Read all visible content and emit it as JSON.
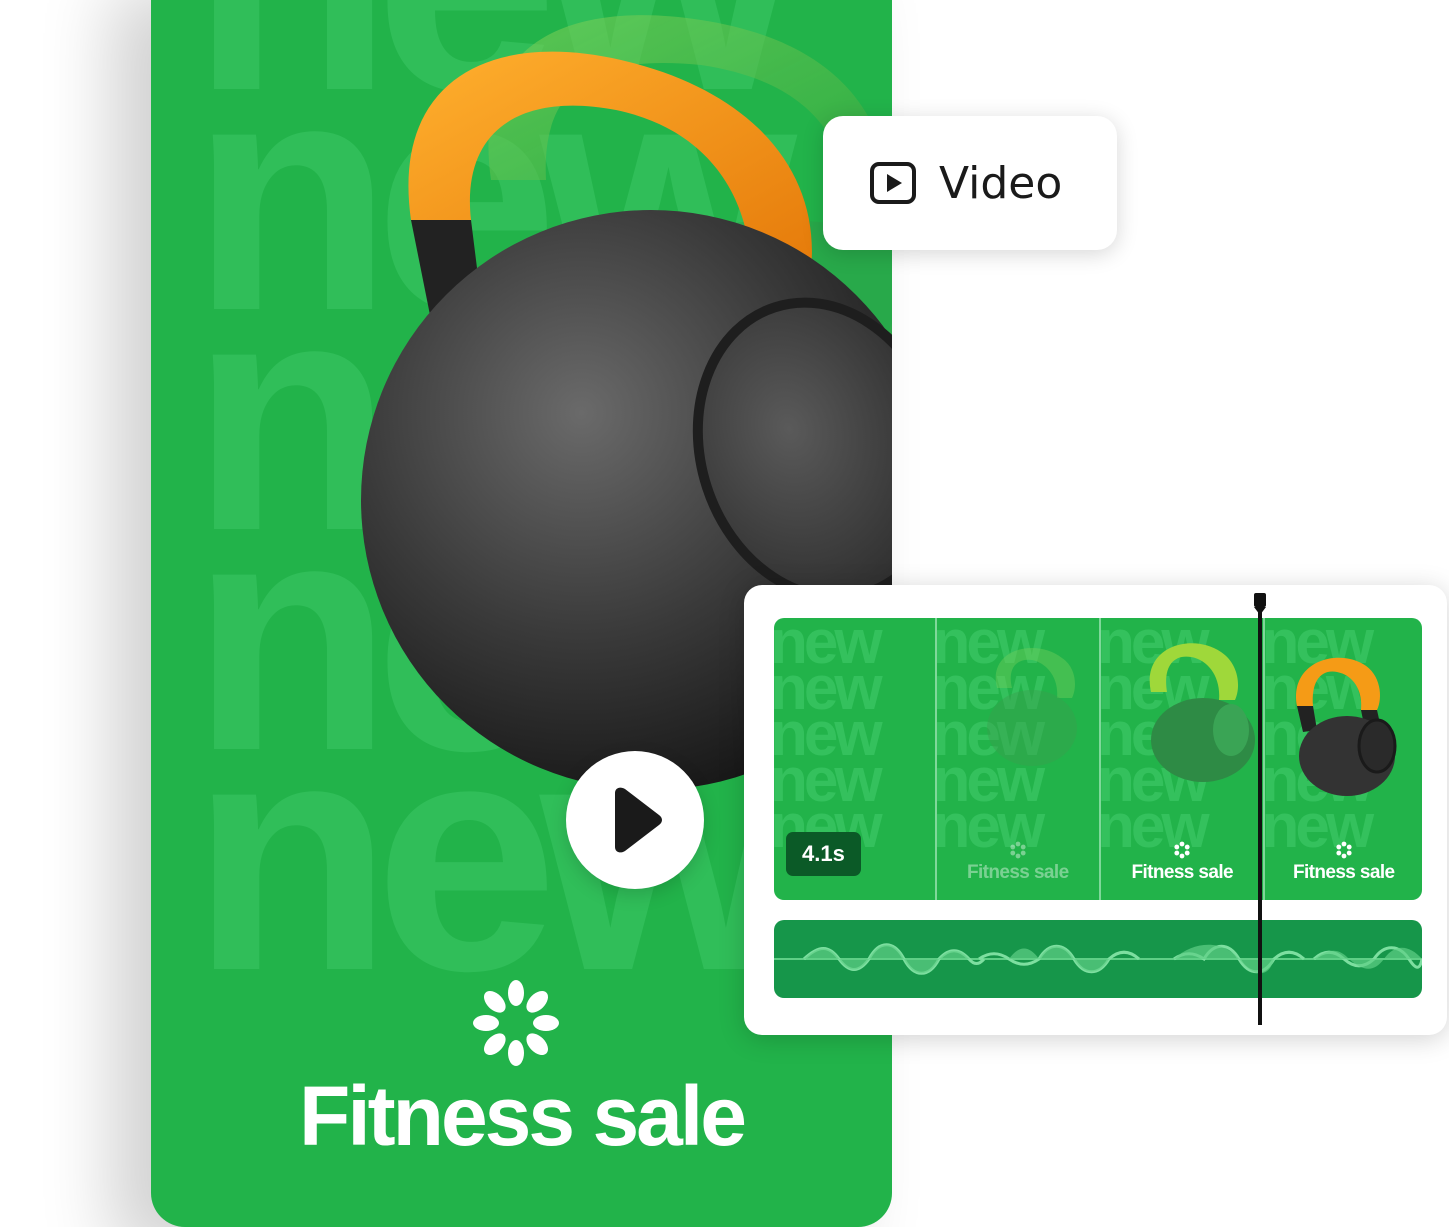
{
  "poster": {
    "background_word": "new",
    "title": "Fitness sale",
    "accent_color": "#22b34a",
    "handle_color": "#f39a14",
    "play_icon": "play-icon"
  },
  "video_chip": {
    "icon": "video-play-icon",
    "label": "Video"
  },
  "timeline": {
    "duration_label": "4.1s",
    "frames": [
      {
        "title": ""
      },
      {
        "title": "Fitness sale"
      },
      {
        "title": "Fitness sale"
      },
      {
        "title": "Fitness sale"
      }
    ],
    "audio_icon": "waveform"
  }
}
